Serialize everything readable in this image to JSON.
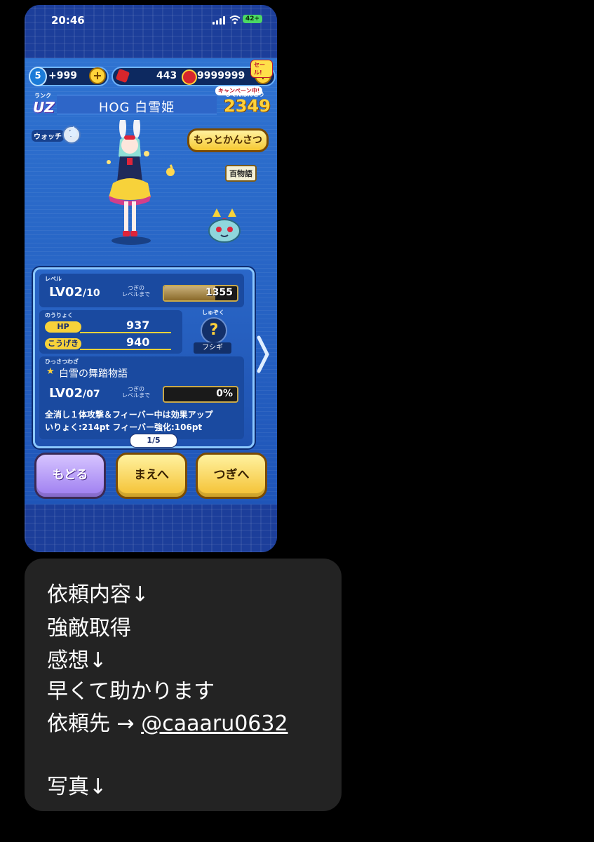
{
  "status_bar": {
    "time": "20:46",
    "battery": "42+"
  },
  "currency": {
    "count_badge": "5",
    "points": "+999",
    "items": "443",
    "coins": "9999999",
    "sale_label": "セール!",
    "campaign_label": "キャンペーン中!"
  },
  "header": {
    "rank_label": "ランク",
    "rank_value": "UZ",
    "title": "HOG 白雪姫",
    "dex_label": "じてんばんごう",
    "dex_number": "2349"
  },
  "watch_label": "ウォッチ",
  "watch_help": "?",
  "observe_button": "もっとかんさつ",
  "tribe_tag": "百物語",
  "level_section": {
    "label": "レベル",
    "level": "LV02",
    "max": "/10",
    "next_label_1": "つぎの",
    "next_label_2": "レベルまで",
    "exp_to_next": "1355",
    "exp_progress": 0.7
  },
  "stats": {
    "label": "のうりょく",
    "hp_label": "HP",
    "hp_value": "937",
    "attack_label": "こうげき",
    "attack_value": "940",
    "species_label": "しゅぞく",
    "species_icon": "?",
    "species_name": "フシギ"
  },
  "skill": {
    "label": "ひっさつわざ",
    "name": "白雪の舞踏物語",
    "level": "LV02",
    "max": "/07",
    "next_label_1": "つぎの",
    "next_label_2": "レベルまで",
    "progress_text": "0%",
    "progress": 0,
    "desc_line1": "全消し１体攻撃＆フィーバー中は効果アップ",
    "desc_line2": "いりょく:214pt フィーバー強化:106pt"
  },
  "pager": "1/5",
  "buttons": {
    "back": "もどる",
    "prev": "まえへ",
    "next": "つぎへ"
  },
  "message": {
    "line1": "依頼内容↓",
    "line2": "強敵取得",
    "line3": "感想↓",
    "line4": "早くて助かります",
    "line5_prefix": "依頼先 → ",
    "line5_handle": "@caaaru0632",
    "line6": "写真↓"
  },
  "colors": {
    "panel_blue": "#2f73d1",
    "gold": "#f7d23a",
    "bubble": "#232323"
  }
}
